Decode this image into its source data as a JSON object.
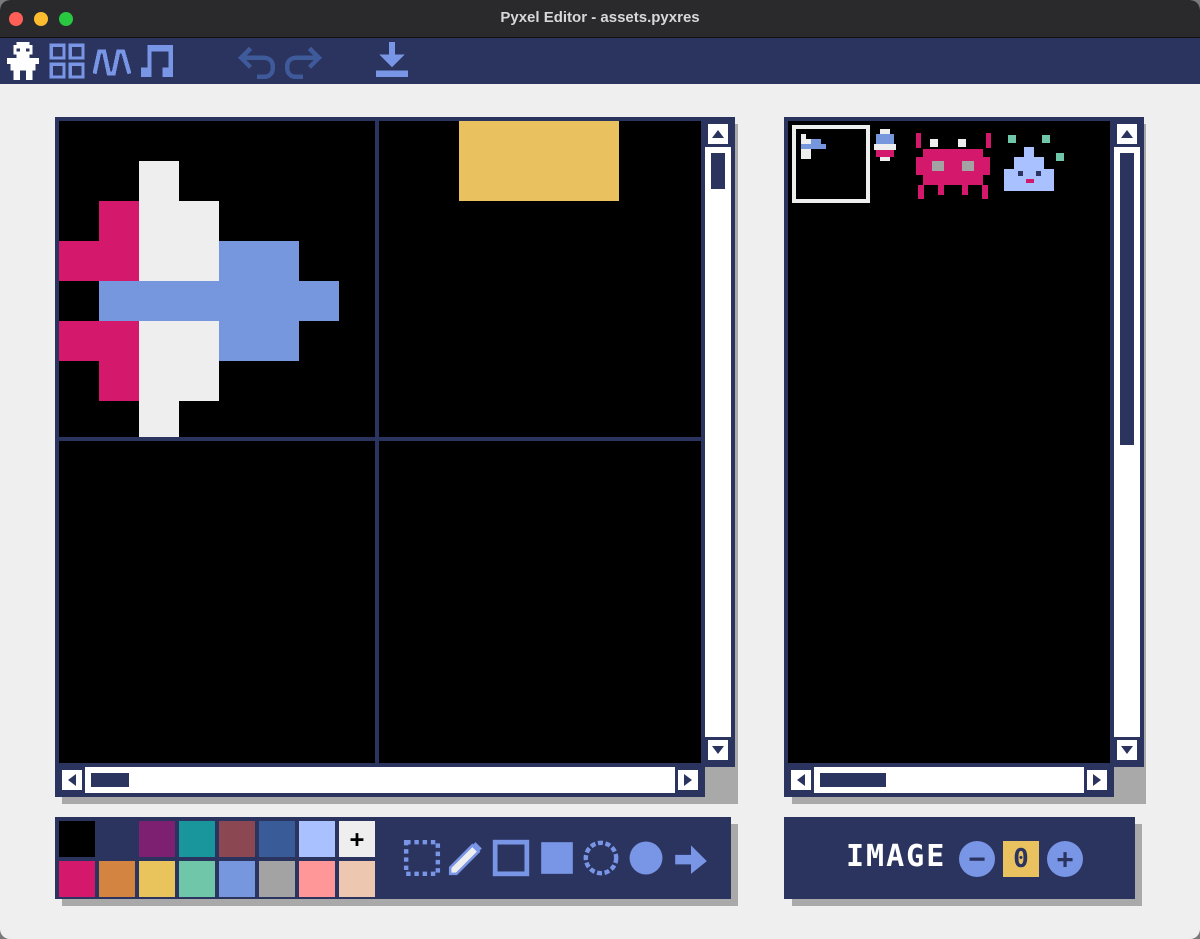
{
  "window": {
    "title": "Pyxel Editor - assets.pyxres"
  },
  "toolbar": {
    "editors": [
      {
        "icon": "image-editor-icon"
      },
      {
        "icon": "tilemap-editor-icon"
      },
      {
        "icon": "sound-editor-icon"
      },
      {
        "icon": "music-editor-icon"
      }
    ],
    "actions": [
      {
        "icon": "undo-icon"
      },
      {
        "icon": "redo-icon"
      },
      {
        "icon": "save-download-icon"
      }
    ]
  },
  "palette": {
    "colors": [
      "#000000",
      "#2b335f",
      "#7e2072",
      "#19959c",
      "#8b4852",
      "#395c98",
      "#a9c1ff",
      "#eeeeee",
      "#d4186c",
      "#d38441",
      "#e9c35b",
      "#70c6a9",
      "#7696de",
      "#a3a3a3",
      "#ff9798",
      "#edc7b0"
    ],
    "add_symbol": "+"
  },
  "tools": [
    {
      "icon": "select-icon"
    },
    {
      "icon": "pencil-icon"
    },
    {
      "icon": "rectangle-outline-icon"
    },
    {
      "icon": "rectangle-filled-icon"
    },
    {
      "icon": "circle-outline-icon"
    },
    {
      "icon": "circle-filled-icon"
    },
    {
      "icon": "bucket-fill-icon"
    }
  ],
  "image_selector": {
    "label": "IMAGE",
    "value": "0",
    "decrement": "−",
    "increment": "+"
  },
  "colors": {
    "navy": "#2b335f",
    "accent_blue": "#7895e6",
    "yellow": "#e9c15f",
    "pink": "#d4186c",
    "white": "#eeeeee"
  }
}
